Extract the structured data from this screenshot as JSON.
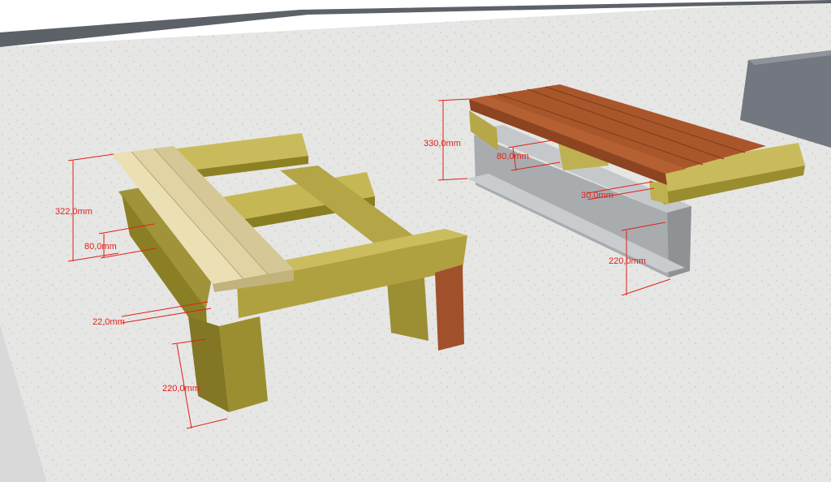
{
  "colors": {
    "concrete": "#e4e4e2",
    "wall": "#6b7077",
    "wood_light": "#c7b85a",
    "wood_mid": "#a89a3c",
    "wood_dark": "#7d7020",
    "plank_light": "#d9c99a",
    "red_wood": "#a8552a",
    "steel": "#b9bcbe",
    "dim_red": "#e0201a"
  },
  "dimensions": {
    "d1": "322,0mm",
    "d2": "80,0mm",
    "d3": "22,0mm",
    "d4": "220,0mm",
    "d5": "330,0mm",
    "d6": "80,0mm",
    "d7": "30,0mm",
    "d8": "220,0mm"
  }
}
